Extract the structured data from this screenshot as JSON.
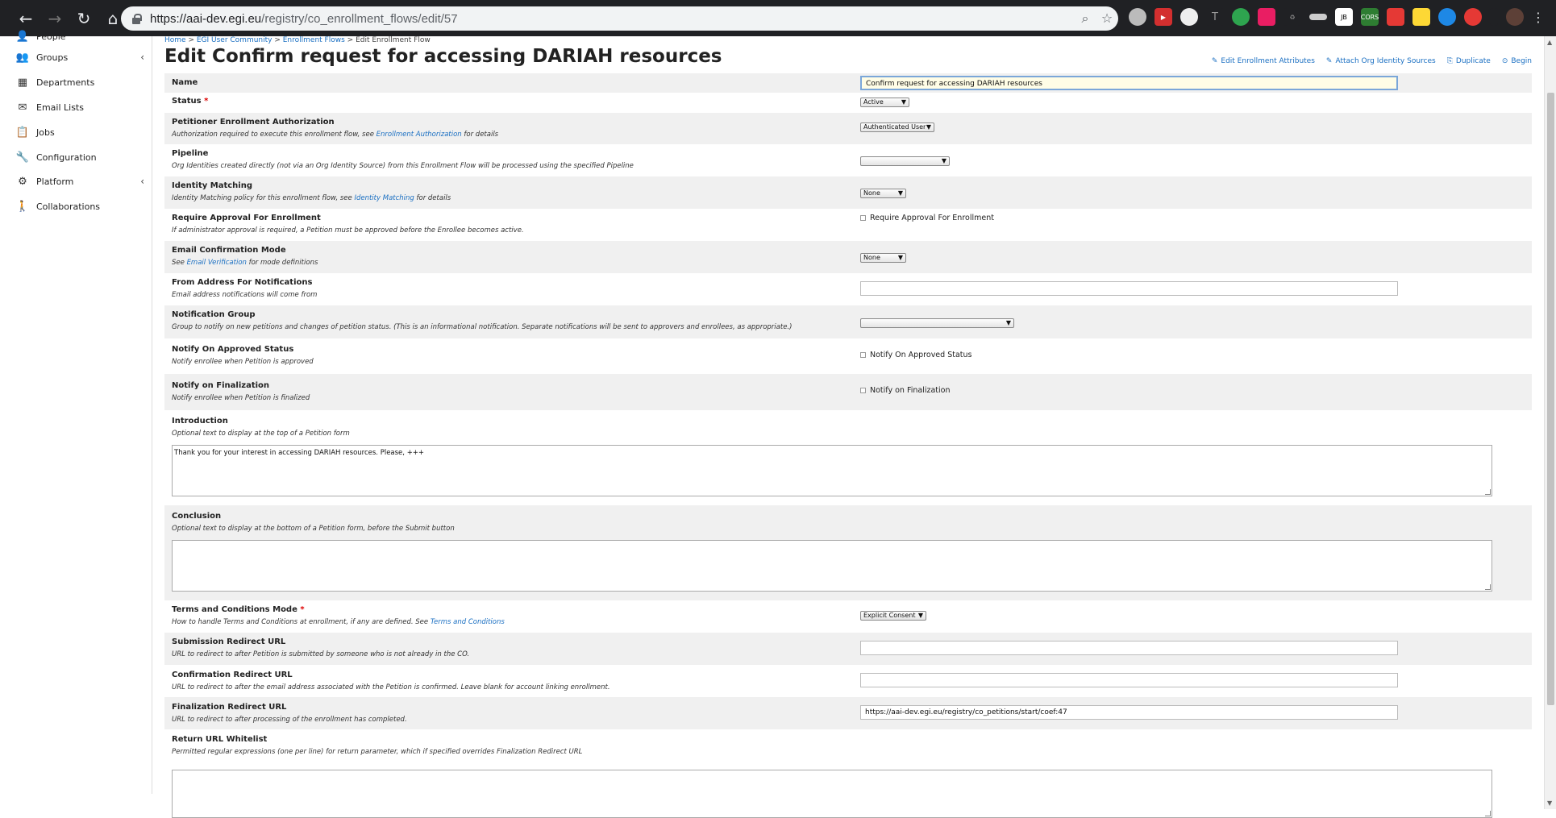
{
  "browser": {
    "url_host": "https://aai-dev.egi.eu",
    "url_path": "/registry/co_enrollment_flows/edit/57"
  },
  "sidebar": {
    "items": [
      {
        "label": "People",
        "icon": "person-icon"
      },
      {
        "label": "Groups",
        "icon": "group-icon",
        "chevron": "‹"
      },
      {
        "label": "Departments",
        "icon": "building-icon"
      },
      {
        "label": "Email Lists",
        "icon": "envelope-icon"
      },
      {
        "label": "Jobs",
        "icon": "clipboard-icon"
      },
      {
        "label": "Configuration",
        "icon": "wrench-icon"
      },
      {
        "label": "Platform",
        "icon": "gear-icon",
        "chevron": "‹"
      },
      {
        "label": "Collaborations",
        "icon": "collaboration-icon"
      }
    ]
  },
  "breadcrumb": {
    "home": "Home",
    "community": "EGI User Community",
    "flows": "Enrollment Flows",
    "current": "Edit Enrollment Flow",
    "sep": " > "
  },
  "page_title": "Edit Confirm request for accessing DARIAH resources",
  "actions": {
    "edit_attributes": "Edit Enrollment Attributes",
    "attach_sources": "Attach Org Identity Sources",
    "duplicate": "Duplicate",
    "begin": "Begin"
  },
  "form": {
    "name": {
      "label": "Name",
      "value": "Confirm request for accessing DARIAH resources"
    },
    "status": {
      "label": "Status",
      "required": "*",
      "value": "Active"
    },
    "petitioner": {
      "label": "Petitioner Enrollment Authorization",
      "desc_pre": "Authorization required to execute this enrollment flow, see ",
      "desc_link": "Enrollment Authorization",
      "desc_post": " for details",
      "value": "Authenticated User"
    },
    "pipeline": {
      "label": "Pipeline",
      "desc": "Org Identities created directly (not via an Org Identity Source) from this Enrollment Flow will be processed using the specified Pipeline",
      "value": ""
    },
    "identity_matching": {
      "label": "Identity Matching",
      "desc_pre": "Identity Matching policy for this enrollment flow, see ",
      "desc_link": "Identity Matching",
      "desc_post": " for details",
      "value": "None"
    },
    "require_approval": {
      "label": "Require Approval For Enrollment",
      "desc": "If administrator approval is required, a Petition must be approved before the Enrollee becomes active.",
      "checkbox_label": "Require Approval For Enrollment"
    },
    "email_confirmation": {
      "label": "Email Confirmation Mode",
      "desc_pre": "See ",
      "desc_link": "Email Verification",
      "desc_post": " for mode definitions",
      "value": "None"
    },
    "from_address": {
      "label": "From Address For Notifications",
      "desc": "Email address notifications will come from",
      "value": ""
    },
    "notification_group": {
      "label": "Notification Group",
      "desc": "Group to notify on new petitions and changes of petition status. (This is an informational notification. Separate notifications will be sent to approvers and enrollees, as appropriate.)",
      "value": ""
    },
    "notify_approved": {
      "label": "Notify On Approved Status",
      "desc": "Notify enrollee when Petition is approved",
      "checkbox_label": "Notify On Approved Status"
    },
    "notify_finalization": {
      "label": "Notify on Finalization",
      "desc": "Notify enrollee when Petition is finalized",
      "checkbox_label": "Notify on Finalization"
    },
    "introduction": {
      "label": "Introduction",
      "desc": "Optional text to display at the top of a Petition form",
      "value": "Thank you for your interest in accessing DARIAH resources. Please, +++"
    },
    "conclusion": {
      "label": "Conclusion",
      "desc": "Optional text to display at the bottom of a Petition form, before the Submit button",
      "value": ""
    },
    "terms_mode": {
      "label": "Terms and Conditions Mode",
      "required": "*",
      "desc_pre": "How to handle Terms and Conditions at enrollment, if any are defined. See ",
      "desc_link": "Terms and Conditions",
      "desc_post": "",
      "value": "Explicit Consent"
    },
    "submission_redirect": {
      "label": "Submission Redirect URL",
      "desc": "URL to redirect to after Petition is submitted by someone who is not already in the CO.",
      "value": ""
    },
    "confirmation_redirect": {
      "label": "Confirmation Redirect URL",
      "desc": "URL to redirect to after the email address associated with the Petition is confirmed. Leave blank for account linking enrollment.",
      "value": ""
    },
    "finalization_redirect": {
      "label": "Finalization Redirect URL",
      "desc": "URL to redirect to after processing of the enrollment has completed.",
      "value": "https://aai-dev.egi.eu/registry/co_petitions/start/coef:47"
    },
    "return_whitelist": {
      "label": "Return URL Whitelist",
      "desc": "Permitted regular expressions (one per line) for return parameter, which if specified overrides Finalization Redirect URL",
      "value": ""
    }
  }
}
